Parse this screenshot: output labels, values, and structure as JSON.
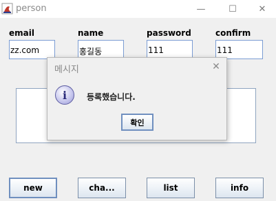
{
  "window": {
    "title": "person",
    "minimize_glyph": "—",
    "maximize_glyph": "☐",
    "close_glyph": "✕"
  },
  "form": {
    "fields": [
      {
        "label": "email",
        "value": "zz.com"
      },
      {
        "label": "name",
        "value": "홍길동"
      },
      {
        "label": "password",
        "value": "111"
      },
      {
        "label": "confirm",
        "value": "111"
      }
    ]
  },
  "buttons": {
    "new": "new",
    "change": "cha...",
    "list": "list",
    "info": "info"
  },
  "dialog": {
    "title": "메시지",
    "message": "등록했습니다.",
    "ok": "확인",
    "close_glyph": "✕",
    "icon_glyph": "i"
  }
}
